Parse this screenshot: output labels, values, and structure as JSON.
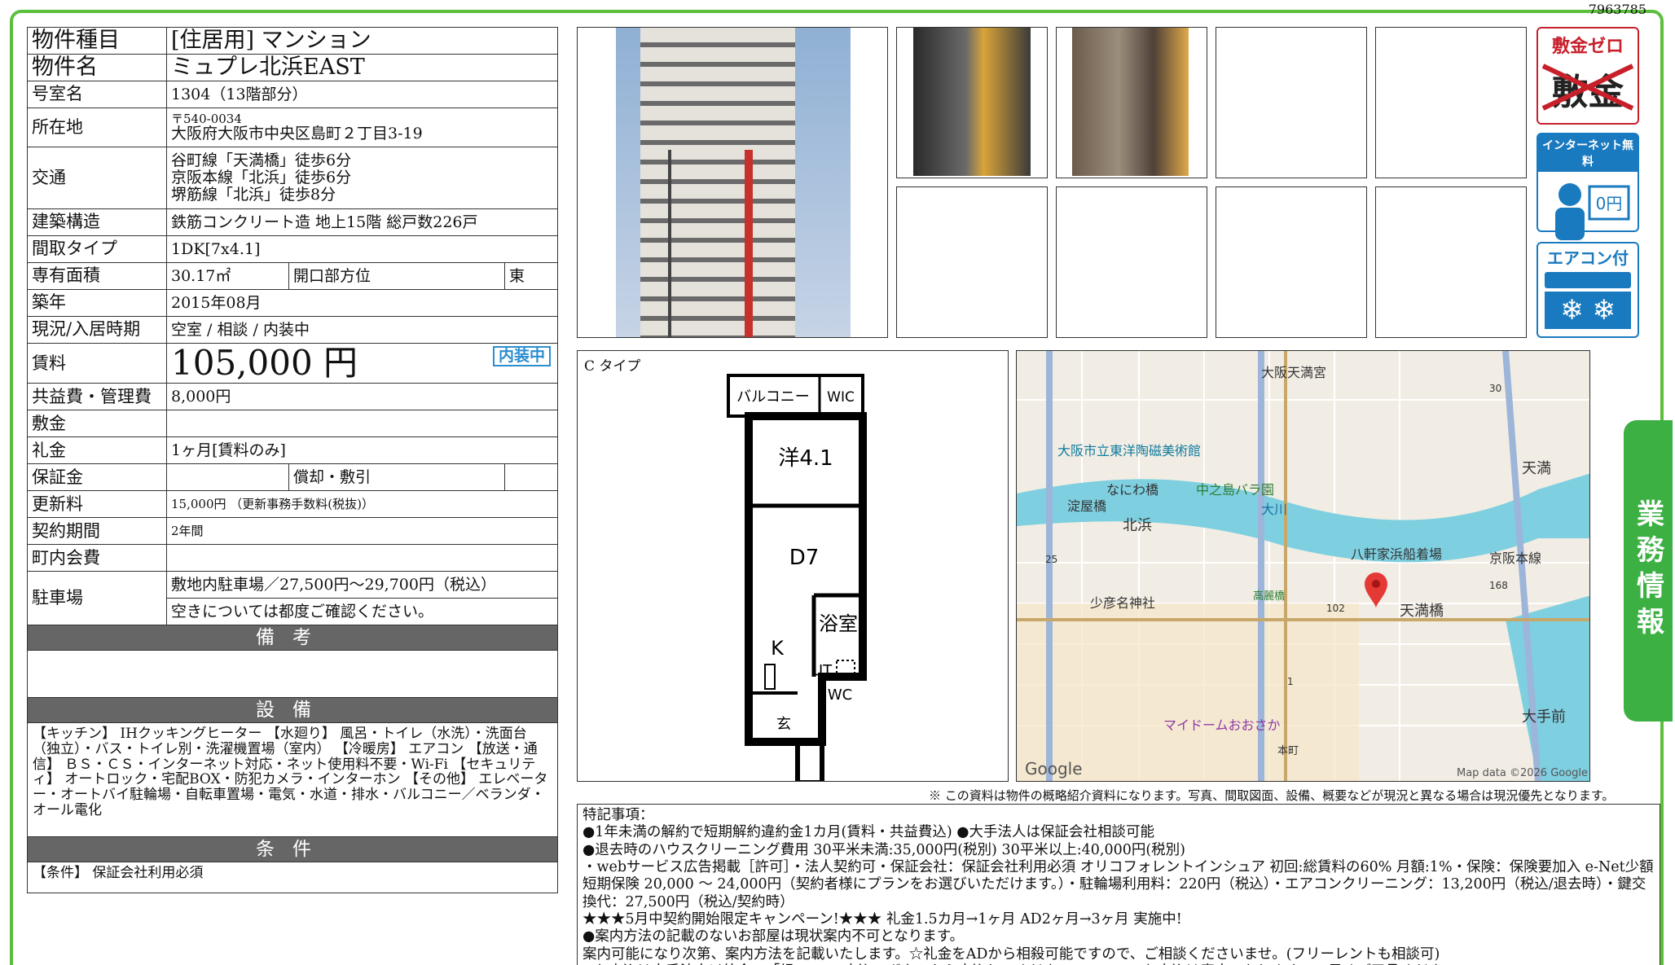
{
  "doc_id": "7963785",
  "property": {
    "type_label": "物件種目",
    "type_value": "[住居用] マンション",
    "name_label": "物件名",
    "name_value": "ミュプレ北浜EAST",
    "room_label": "号室名",
    "room_value": "1304（13階部分）",
    "addr_label": "所在地",
    "addr_zip": "〒540-0034",
    "addr_value": "大阪府大阪市中央区島町２丁目3-19",
    "traffic_label": "交通",
    "traffic": [
      "谷町線「天満橋」徒歩6分",
      "京阪本線「北浜」徒歩6分",
      "堺筋線「北浜」徒歩8分"
    ],
    "struct_label": "建築構造",
    "struct_value": "鉄筋コンクリート造 地上15階 総戸数226戸",
    "layout_label": "間取タイプ",
    "layout_value": "1DK[7x4.1]",
    "area_label": "専有面積",
    "area_value": "30.17㎡",
    "open_label": "開口部方位",
    "open_value": "東",
    "built_label": "築年",
    "built_value": "2015年08月",
    "status_label": "現況/入居時期",
    "status_value": "空室 / 相談 / 内装中",
    "rent_label": "賃料",
    "rent_value": "105,000 円",
    "naiso_badge": "内装中",
    "fee_label": "共益費・管理費",
    "fee_value": "8,000円",
    "deposit_label": "敷金",
    "deposit_value": "",
    "key_label": "礼金",
    "key_value": "1ヶ月[賃料のみ]",
    "guar_label": "保証金",
    "guar_value": "",
    "amort_label": "償却・敷引",
    "amort_value": "",
    "renew_label": "更新料",
    "renew_value": "15,000円 （更新事務手数料(税抜)）",
    "period_label": "契約期間",
    "period_value": "2年間",
    "town_label": "町内会費",
    "town_value": "",
    "parking_label": "駐車場",
    "parking_value": "敷地内駐車場／27,500円〜29,700円（税込）",
    "parking_note": "空きについては都度ご確認ください。"
  },
  "sections": {
    "remarks": "備考",
    "equipment": "設備",
    "conditions": "条件"
  },
  "equipment_text": "【キッチン】 IHクッキングヒーター 【水廻り】 風呂・トイレ（水洗）・洗面台（独立）・バス・トイレ別・洗濯機置場（室内） 【冷暖房】 エアコン 【放送・通信】 ＢＳ・ＣＳ・インターネット対応・ネット使用料不要・Wi-Fi 【セキュリティ】 オートロック・宅配BOX・防犯カメラ・インターホン 【その他】 エレベーター・オートバイ駐輪場・自転車置場・電気・水道・排水・バルコニー／ベランダ・オール電化",
  "conditions_text": "【条件】 保証会社利用必須",
  "icons": {
    "shikikin_zero": "敷金ゼロ",
    "shikikin_struck": "敷金",
    "internet": "インターネット無料",
    "internet_yen": "0円",
    "aircon": "エアコン付"
  },
  "side_tab": "業務情報",
  "floorplan": {
    "type_label": "C タイプ",
    "rooms": [
      "バルコニー",
      "WIC",
      "洋4.1",
      "D7",
      "浴室",
      "K",
      "UT",
      "WC",
      "玄"
    ]
  },
  "map": {
    "labels": [
      "大阪天満宮",
      "大阪市立東洋陶磁美術館",
      "なにわ橋",
      "中之島バラ園",
      "淀屋橋",
      "北浜",
      "大川",
      "八軒家浜船着場",
      "京阪本線",
      "少彦名神社",
      "高麗橋",
      "天満橋",
      "マイドームおおさか",
      "天満",
      "大手前",
      "本町"
    ],
    "road_numbers": [
      "30",
      "25",
      "102",
      "168",
      "1"
    ],
    "credit": "Map data ©2026 Google",
    "logo": "Google"
  },
  "disclaimer": "※ この資料は物件の概略紹介資料になります。写真、間取図面、設備、概要などが現況と異なる場合は現況優先となります。",
  "special_notes": "特記事項：\n●1年未満の解約で短期解約違約金1カ月(賃料・共益費込) ●大手法人は保証会社相談可能\n●退去時のハウスクリーニング費用 30平米未満:35,000円(税別) 30平米以上:40,000円(税別)\n・webサービス広告掲載［許可］・法人契約可・保証会社：保証会社利用必須 オリコフォレントインシュア 初回:総賃料の60% 月額:1%・保険：保険要加入 e-Net少額短期保険 20,000 〜 24,000円（契約者様にプランをお選びいただけます。）・駐輪場利用料：220円（税込）・エアコンクリーニング：13,200円（税込/退去時）・鍵交換代：27,500円（税込/契約時）\n★★★5月中契約開始限定キャンペーン!★★★ 礼金1.5カ月→1ヶ月 AD2ヶ月→3ヶ月 実施中!\n●案内方法の記載のないお部屋は現状案内不可となります。\n案内可能になり次第、案内方法を記載いたします。☆礼金をADから相殺可能ですので、ご相談くださいませ。(フリーレントも相談可)\n※お申込は大手法人以外全て「緑のWEB申込」ボタンから申込してください。FAXでのお申込は廃止いたしますので予めご了承ください。"
}
